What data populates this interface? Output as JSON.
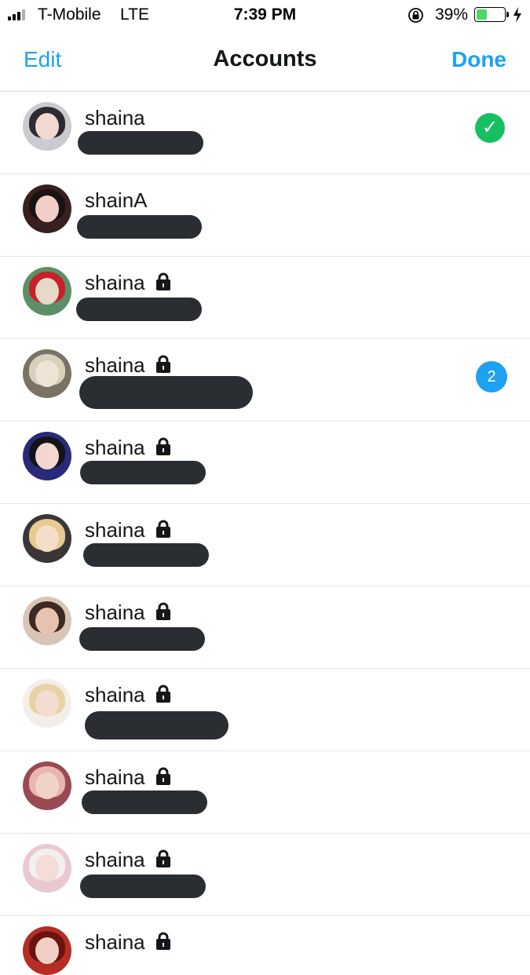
{
  "status_bar": {
    "carrier": "T-Mobile",
    "network": "LTE",
    "time": "7:39 PM",
    "battery_percent_label": "39%",
    "battery_level": 0.39,
    "colors": {
      "battery_fill": "#4cd964"
    }
  },
  "nav": {
    "edit_label": "Edit",
    "title": "Accounts",
    "done_label": "Done",
    "colors": {
      "accent": "#1da1f2"
    }
  },
  "accounts": [
    {
      "name": "shaina",
      "locked": false,
      "status": "current",
      "avatar_colors": [
        "#c9cbd1",
        "#2b2b30",
        "#f1d9d2"
      ]
    },
    {
      "name": "shainA",
      "locked": false,
      "status": null,
      "avatar_colors": [
        "#3a1f20",
        "#1b1212",
        "#f0cfc6"
      ]
    },
    {
      "name": "shaina",
      "locked": true,
      "status": null,
      "avatar_colors": [
        "#5d8f66",
        "#c8212b",
        "#e6d9c8"
      ]
    },
    {
      "name": "shaina",
      "locked": true,
      "status": "badge",
      "badge_count": "2",
      "avatar_colors": [
        "#7a7264",
        "#d8d0b8",
        "#efe3d6"
      ]
    },
    {
      "name": "shaina",
      "locked": true,
      "status": null,
      "avatar_colors": [
        "#2a2a7a",
        "#141418",
        "#f2d6cf"
      ]
    },
    {
      "name": "shaina",
      "locked": true,
      "status": null,
      "avatar_colors": [
        "#3a3638",
        "#e8c98f",
        "#f4ddc9"
      ]
    },
    {
      "name": "shaina",
      "locked": true,
      "status": null,
      "avatar_colors": [
        "#d9c4b8",
        "#3d2a22",
        "#e8c2b0"
      ]
    },
    {
      "name": "shaina",
      "locked": true,
      "status": null,
      "avatar_colors": [
        "#f3eee9",
        "#e6d3a6",
        "#f2ddd0"
      ]
    },
    {
      "name": "shaina",
      "locked": true,
      "status": null,
      "avatar_colors": [
        "#9a4a52",
        "#e8b6ae",
        "#f0d3c8"
      ]
    },
    {
      "name": "shaina",
      "locked": true,
      "status": null,
      "avatar_colors": [
        "#e9c9cf",
        "#f2f0ee",
        "#f3ddd6"
      ]
    },
    {
      "name": "shaina",
      "locked": true,
      "status": null,
      "partial": true,
      "avatar_colors": [
        "#b52d25",
        "#6a1410",
        "#f0cfc6"
      ]
    }
  ],
  "colors": {
    "check": "#17bf63",
    "badge": "#1da1f2",
    "redaction": "#2a2d31",
    "divider": "#e1e4e7"
  }
}
